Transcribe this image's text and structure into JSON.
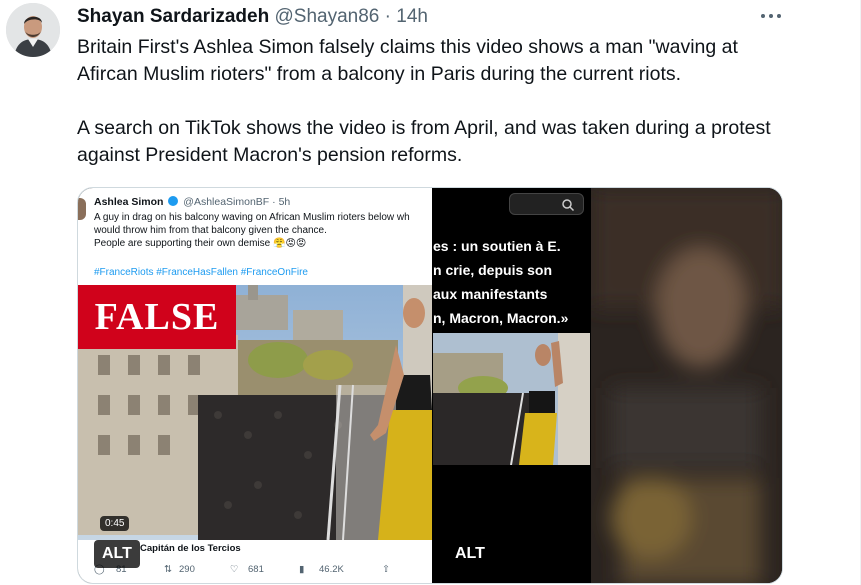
{
  "tweet": {
    "author_name": "Shayan Sardarizadeh",
    "author_handle": "@Shayan86",
    "separator": "·",
    "time": "14h",
    "paragraphs": [
      "Britain First's Ashlea Simon falsely claims this video shows a man \"waving at Afircan Muslim rioters\" from a balcony in Paris during the current riots.",
      "A search on TikTok shows the video is from April, and was taken during a protest against President Macron's pension reforms."
    ]
  },
  "media": {
    "embedded_tweet": {
      "name": "Ashlea Simon",
      "handle": "@AshleaSimonBF",
      "time": "· 5h",
      "lines": [
        "A guy in drag on his balcony waving on African Muslim rioters below wh",
        "would throw him from that balcony given the chance.",
        "People are supporting their own demise 😤😡😡"
      ],
      "hashtags": "#FranceRiots #FranceHasFallen #FranceOnFire",
      "false_label": "FALSE",
      "duration": "0:45",
      "reply_name": "Capitán de los Tercios",
      "stats": {
        "replies": "81",
        "retweets": "290",
        "likes": "681",
        "views": "46.2K"
      }
    },
    "tiktok_overlay_lines": [
      "es :  un soutien à E.",
      "n crie, depuis son",
      " aux manifestants",
      "n, Macron, Macron.»"
    ],
    "alt_label": "ALT"
  },
  "colors": {
    "accent": "#1d9bf0",
    "false_red": "#d0021b",
    "muted": "#536471"
  }
}
